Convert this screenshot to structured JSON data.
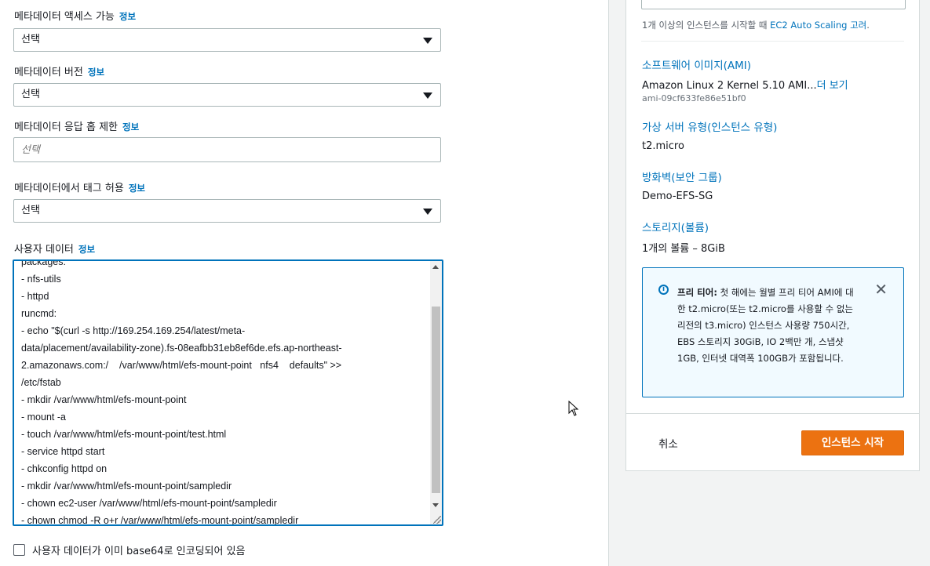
{
  "form": {
    "metadata_access": {
      "label": "메타데이터 액세스 가능",
      "info": "정보",
      "value": "선택"
    },
    "metadata_version": {
      "label": "메타데이터 버전",
      "info": "정보",
      "value": "선택"
    },
    "metadata_hop_limit": {
      "label": "메타데이터 응답 홉 제한",
      "info": "정보",
      "placeholder": "선택"
    },
    "metadata_tags": {
      "label": "메타데이터에서 태그 허용",
      "info": "정보",
      "value": "선택"
    },
    "user_data": {
      "label": "사용자 데이터",
      "info": "정보",
      "lines": [
        "packages:",
        "- nfs-utils",
        "- httpd",
        "runcmd:",
        "- echo \"$(curl -s http://169.254.169.254/latest/meta-",
        "data/placement/availability-zone).fs-08eafbb31eb8ef6de.efs.ap-northeast-",
        "2.amazonaws.com:/    /var/www/html/efs-mount-point   nfs4    defaults\" >>",
        "/etc/fstab",
        "- mkdir /var/www/html/efs-mount-point",
        "- mount -a",
        "- touch /var/www/html/efs-mount-point/test.html",
        "- service httpd start",
        "- chkconfig httpd on",
        "- mkdir /var/www/html/efs-mount-point/sampledir",
        "- chown ec2-user /var/www/html/efs-mount-point/sampledir",
        "- chown chmod -R o+r /var/www/html/efs-mount-point/sampledir"
      ]
    },
    "base64_checkbox_label": "사용자 데이터가 이미 base64로 인코딩되어 있음"
  },
  "summary": {
    "hint_prefix": "1개 이상의 인스턴스를 시작할 때 ",
    "hint_link": "EC2 Auto Scaling 고려",
    "hint_suffix": ".",
    "ami": {
      "title": "소프트웨어 이미지(AMI)",
      "value": "Amazon Linux 2 Kernel 5.10 AMI...",
      "more": "더 보기",
      "id": "ami-09cf633fe86e51bf0"
    },
    "instance_type": {
      "title": "가상 서버 유형(인스턴스 유형)",
      "value": "t2.micro"
    },
    "security_group": {
      "title": "방화벽(보안 그룹)",
      "value": "Demo-EFS-SG"
    },
    "storage": {
      "title": "스토리지(볼륨)",
      "value": "1개의 볼륨 – 8GiB"
    },
    "free_tier": {
      "bold": "프리 티어:",
      "text": " 첫 해에는 월별 프리 티어 AMI에 대한 t2.micro(또는 t2.micro를 사용할 수 없는 리전의 t3.micro) 인스턴스 사용량 750시간, EBS 스토리지 30GiB, IO 2백만 개, 스냅샷 1GB, 인터넷 대역폭 100GB가 포함됩니다."
    },
    "cancel_label": "취소",
    "launch_label": "인스턴스 시작"
  },
  "colors": {
    "accent": "#0073bb",
    "launch_button": "#ec7211"
  }
}
